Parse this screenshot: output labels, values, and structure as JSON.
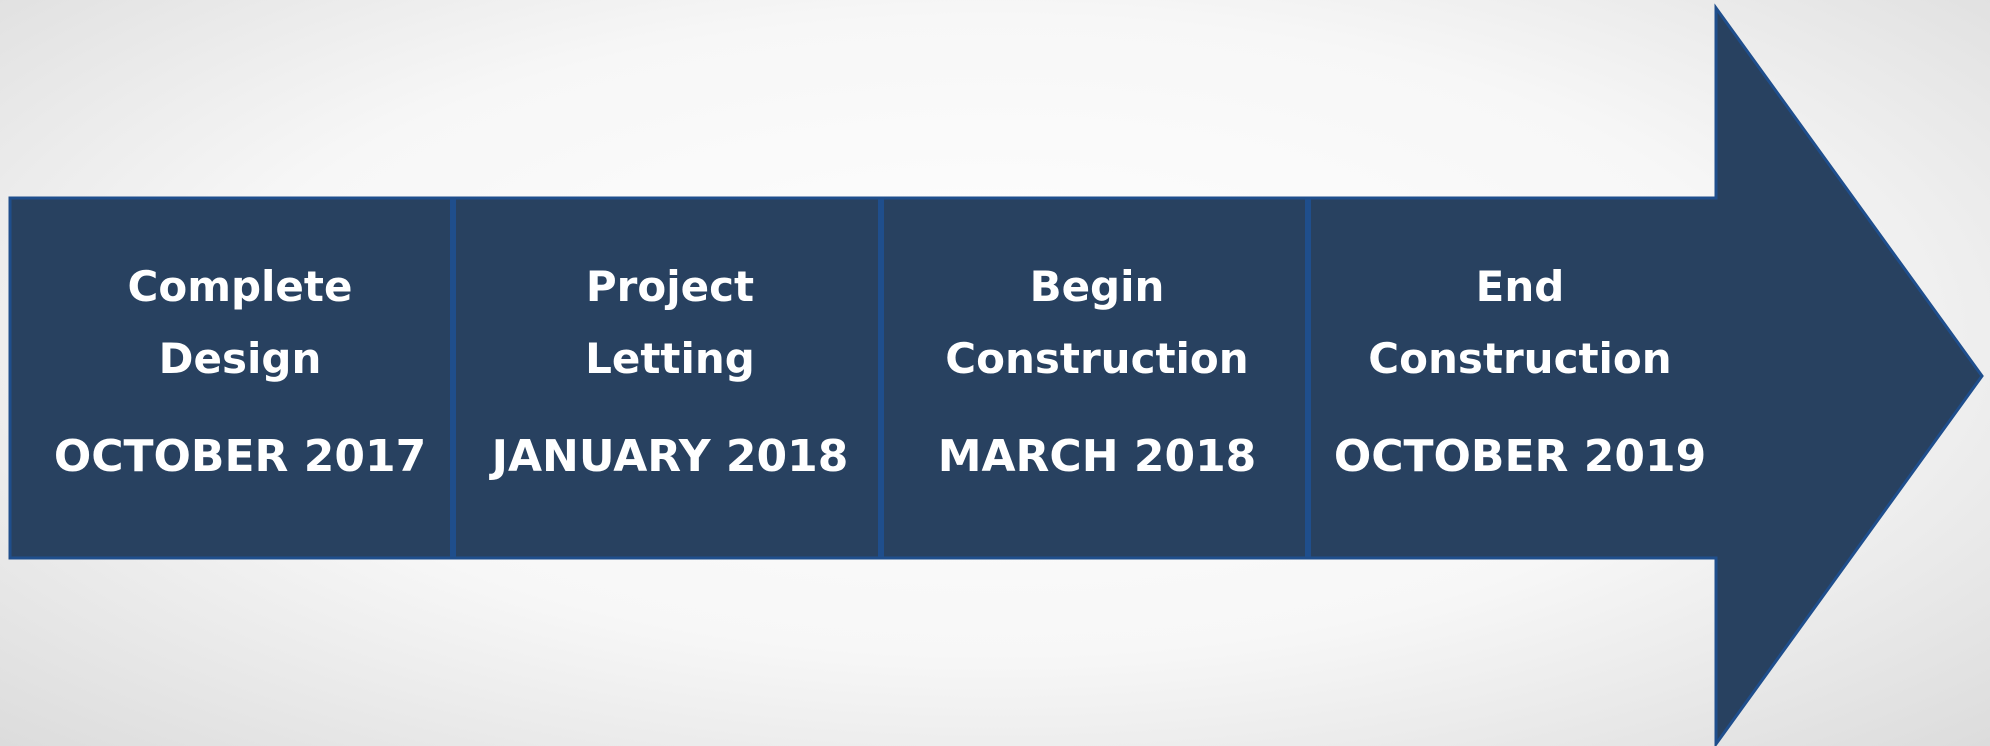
{
  "colors": {
    "arrow_fill": "#284160",
    "arrow_stroke": "#1f4e8c",
    "text": "#ffffff"
  },
  "milestones": [
    {
      "title_line1": "Complete",
      "title_line2": "Design",
      "date": "OCTOBER 2017"
    },
    {
      "title_line1": "Project",
      "title_line2": "Letting",
      "date": "JANUARY 2018"
    },
    {
      "title_line1": "Begin",
      "title_line2": "Construction",
      "date": "MARCH 2018"
    },
    {
      "title_line1": "End",
      "title_line2": "Construction",
      "date": "OCTOBER 2019"
    }
  ]
}
